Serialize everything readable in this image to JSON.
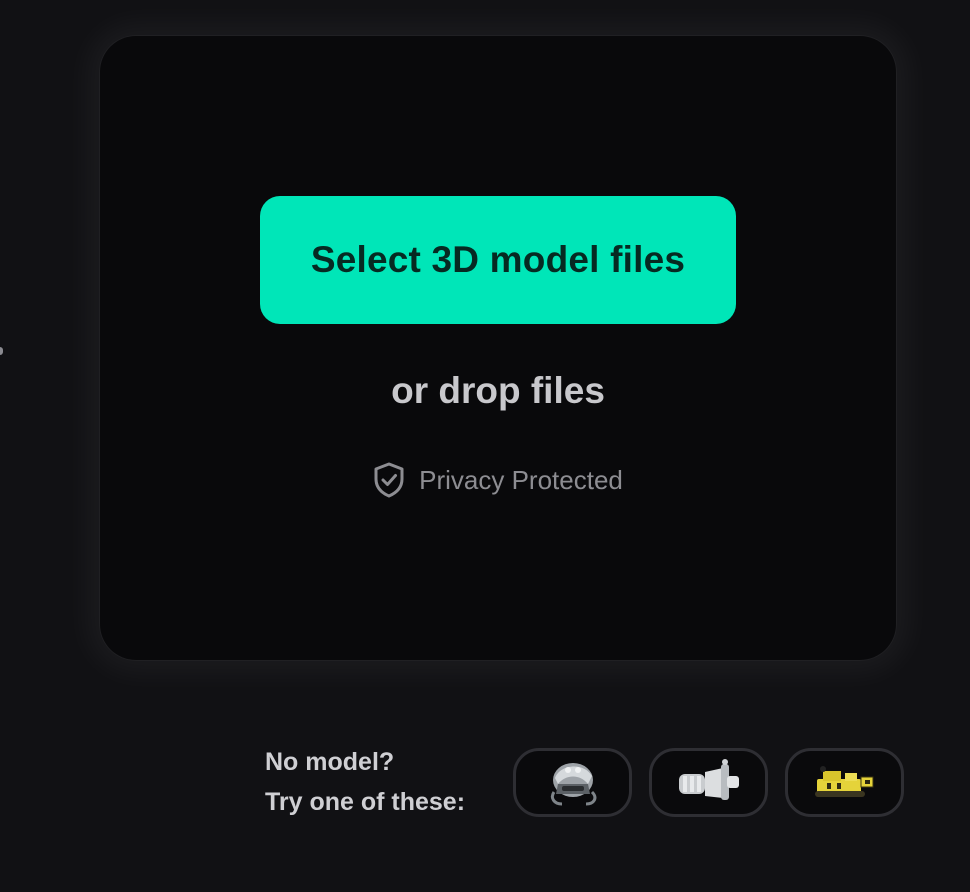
{
  "upload": {
    "select_button_label": "Select 3D model files",
    "drop_label": "or drop files",
    "privacy_label": "Privacy Protected",
    "privacy_icon": "shield-check-icon"
  },
  "examples": {
    "line1": "No model?",
    "line2": "Try one of these:",
    "items": [
      {
        "icon": "helmet-model-icon",
        "color": "#bfc4c8"
      },
      {
        "icon": "motor-part-model-icon",
        "color": "#d7d9dc"
      },
      {
        "icon": "yellow-machine-model-icon",
        "color": "#e5d33a"
      }
    ]
  },
  "colors": {
    "accent": "#00e6b8",
    "button_text": "#062a22",
    "panel": "#09090b",
    "background": "#111114"
  }
}
